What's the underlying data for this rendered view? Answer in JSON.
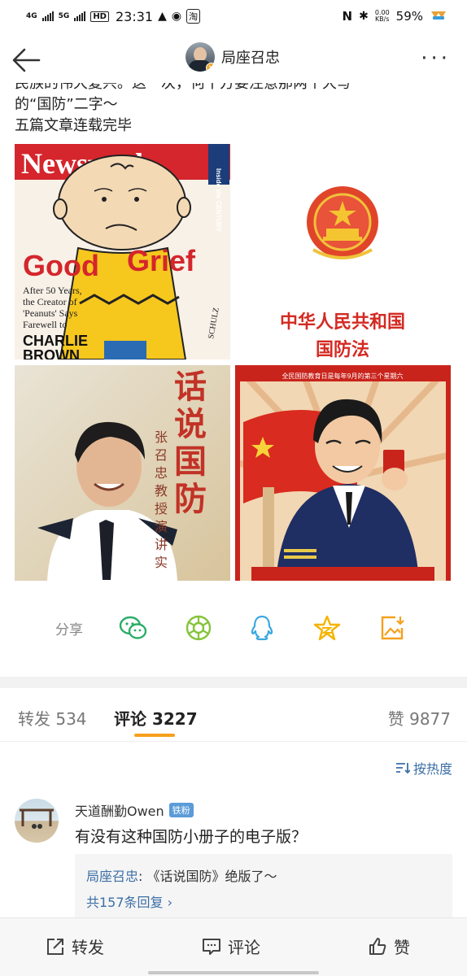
{
  "status_bar": {
    "net1": "4G",
    "net2": "5G",
    "hd": "HD",
    "hd_sub": "2",
    "time": "23:31",
    "speed_value": "0.00",
    "speed_unit": "KB/s",
    "battery": "59%"
  },
  "header": {
    "title": "局座召忠",
    "verified_badge": "v"
  },
  "post": {
    "line_clipped": "民族的伟大复兴。这一次，何干方要注意那两个大写",
    "line2": "的“国防”二字～",
    "line3": "五篇文章连载完毕"
  },
  "images": {
    "img1": {
      "masthead": "Newsweek",
      "corner": "Inside the CENTURY",
      "headline1": "Good",
      "headline2": "Grief",
      "subtext1": "After 50 Years,",
      "subtext2": "the Creator of",
      "subtext3": "'Peanuts' Says",
      "subtext4": "Farewell to",
      "subtext5": "CHARLIE",
      "subtext6": "BROWN",
      "signature": "SCHULZ"
    },
    "img2": {
      "line1": "中华人民共和国",
      "line2": "国防法"
    },
    "img3": {
      "title": "话说国防",
      "subtitle": "——张召忠教授演讲实录"
    },
    "img4": {
      "banner": "全民国防教育日是每年9月的第三个星期六"
    }
  },
  "share": {
    "label": "分享",
    "icons": [
      "wechat-icon",
      "moments-icon",
      "qq-icon",
      "qzone-icon",
      "save-image-icon"
    ]
  },
  "tabs": {
    "repost_label": "转发",
    "repost_count": "534",
    "comment_label": "评论",
    "comment_count": "3227",
    "like_label": "赞",
    "like_count": "9877"
  },
  "sort": {
    "label": "按热度"
  },
  "comment": {
    "username": "天道酬勤Owen",
    "fan_badge": "铁粉",
    "text": "有没有这种国防小册子的电子版？",
    "reply_author": "局座召忠",
    "reply_colon": ":",
    "reply_text": "《话说国防》绝版了～",
    "reply_more": "共157条回复"
  },
  "bottom_bar": {
    "repost": "转发",
    "comment": "评论",
    "like": "赞"
  },
  "colors": {
    "accent": "#f7a01c",
    "link": "#3c6fa6",
    "wechat": "#2aae67",
    "moments": "#84c43a",
    "qq": "#3aa8e0",
    "qzone": "#f5b400"
  }
}
